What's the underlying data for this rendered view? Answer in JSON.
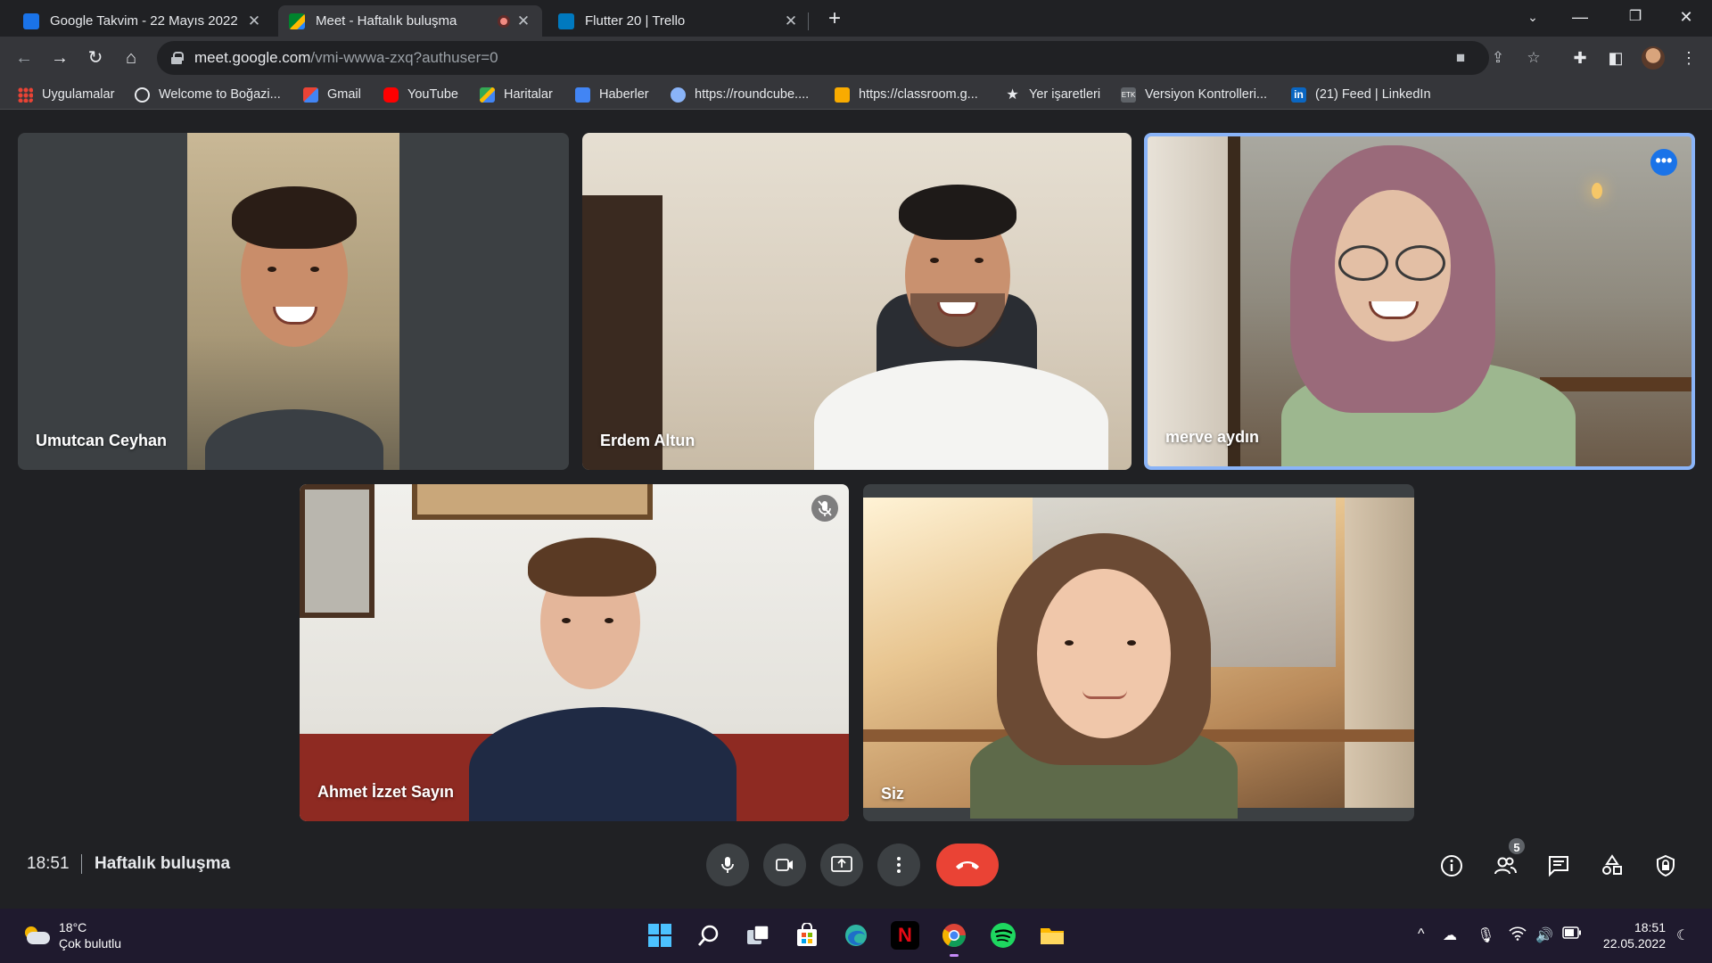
{
  "browser": {
    "tabs": [
      {
        "title": "Google Takvim - 22 Mayıs 2022 h",
        "active": false
      },
      {
        "title": "Meet - Haftalık buluşma",
        "active": true
      },
      {
        "title": "Flutter 20 | Trello",
        "active": false
      }
    ],
    "new_tab": "+",
    "url_host": "meet.google.com",
    "url_path": "/vmi-wwwa-zxq?authuser=0"
  },
  "bookmarks": [
    {
      "label": "Uygulamalar",
      "icon": "apps-grid-icon",
      "color": "#4285f4"
    },
    {
      "label": "Welcome to Boğazi...",
      "icon": "globe-icon",
      "color": "#e8eaed"
    },
    {
      "label": "Gmail",
      "icon": "gmail-icon",
      "color": "#ea4335"
    },
    {
      "label": "YouTube",
      "icon": "youtube-icon",
      "color": "#ff0000"
    },
    {
      "label": "Haritalar",
      "icon": "maps-icon",
      "color": "#34a853"
    },
    {
      "label": "Haberler",
      "icon": "news-icon",
      "color": "#4285f4"
    },
    {
      "label": "https://roundcube....",
      "icon": "roundcube-icon",
      "color": "#8ab4f8"
    },
    {
      "label": "https://classroom.g...",
      "icon": "classroom-icon",
      "color": "#f9ab00"
    },
    {
      "label": "Yer işaretleri",
      "icon": "star-icon",
      "color": "#e8eaed"
    },
    {
      "label": "Versiyon Kontrolleri...",
      "icon": "etk-icon",
      "color": "#bdc1c6"
    },
    {
      "label": "(21) Feed | LinkedIn",
      "icon": "linkedin-icon",
      "color": "#0a66c2"
    }
  ],
  "participants": [
    {
      "name": "Umutcan Ceyhan",
      "speaking": false,
      "muted": false
    },
    {
      "name": "Erdem Altun",
      "speaking": false,
      "muted": false
    },
    {
      "name": "merve aydın",
      "speaking": true,
      "muted": false
    },
    {
      "name": "Ahmet İzzet Sayın",
      "speaking": false,
      "muted": true
    },
    {
      "name": "Siz",
      "speaking": false,
      "muted": false
    }
  ],
  "meeting": {
    "time": "18:51",
    "title": "Haftalık buluşma",
    "participant_count": "5"
  },
  "taskbar": {
    "temperature": "18°C",
    "weather": "Çok bulutlu",
    "clock_time": "18:51",
    "clock_date": "22.05.2022"
  },
  "colors": {
    "end_call": "#ea4335",
    "speaking_border": "#8ab4f8",
    "meet_background": "#202124"
  }
}
